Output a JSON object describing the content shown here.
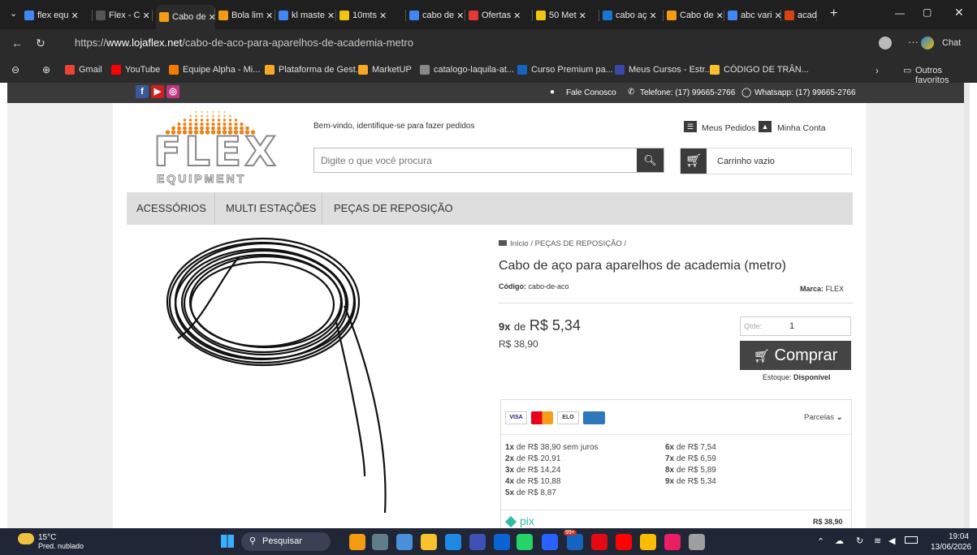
{
  "browser": {
    "tabs": [
      {
        "label": "flex equ",
        "color": "#4285f4"
      },
      {
        "label": "Flex - C",
        "color": "#555555"
      },
      {
        "label": "Cabo de",
        "color": "#f39c12",
        "active": true
      },
      {
        "label": "Bola lim",
        "color": "#f39c12"
      },
      {
        "label": "kl maste",
        "color": "#4285f4"
      },
      {
        "label": "10mts",
        "color": "#f1c40f"
      },
      {
        "label": "cabo de",
        "color": "#4285f4"
      },
      {
        "label": "Ofertas",
        "color": "#e53935"
      },
      {
        "label": "50 Met",
        "color": "#f1c40f"
      },
      {
        "label": "cabo aç",
        "color": "#1976d2"
      },
      {
        "label": "Cabo de",
        "color": "#f39c12"
      },
      {
        "label": "abc vari",
        "color": "#4285f4"
      },
      {
        "label": "academ",
        "color": "#d84315"
      }
    ],
    "new_tab": "+",
    "url_prefix": "https://",
    "url_domain": "www.lojaflex.net",
    "url_path": "/cabo-de-aco-para-aparelhos-de-academia-metro",
    "chat_label": "Chat",
    "bookmarks": [
      {
        "label": "Gmail",
        "color": "#ea4335"
      },
      {
        "label": "YouTube",
        "color": "#ff0000"
      },
      {
        "label": "Equipe Alpha - Mi...",
        "color": "#f57c00"
      },
      {
        "label": "Plataforma de Gest...",
        "color": "#f9a825"
      },
      {
        "label": "MarketUP",
        "color": "#f9a825"
      },
      {
        "label": "catalogo-laquila-at...",
        "color": "#888888"
      },
      {
        "label": "Curso Premium pa...",
        "color": "#1565c0"
      },
      {
        "label": "Meus Cursos - Estr...",
        "color": "#3949ab"
      },
      {
        "label": "CÓDIGO DE TRÂN...",
        "color": "#fbc02d"
      }
    ],
    "other_favorites": "Outros favoritos"
  },
  "site": {
    "social": [
      {
        "label": "f",
        "color": "#3b5998"
      },
      {
        "label": "▶",
        "color": "#cd201f"
      },
      {
        "label": "◎",
        "color": "#c13584"
      }
    ],
    "contact": "Fale Conosco",
    "phone": "Telefone: (17) 99665-2766",
    "whatsapp": "Whatsapp: (17) 99665-2766",
    "logo_text": "FLEX",
    "logo_sub": "EQUIPMENT",
    "welcome": "Bem-vindo, identifique-se para fazer pedidos",
    "my_orders": "Meus Pedidos",
    "my_account": "Minha Conta",
    "search_placeholder": "Digite o que você procura",
    "cart_label": "Carrinho vazio",
    "nav": [
      "ACESSÓRIOS",
      "MULTI ESTAÇÕES",
      "PEÇAS DE REPOSIÇÃO"
    ]
  },
  "product": {
    "breadcrumb_home": "Início",
    "breadcrumb_cat": "PEÇAS DE REPOSIÇÃO",
    "breadcrumb_sep": "/",
    "title": "Cabo de aço para aparelhos de academia (metro)",
    "code_label": "Código:",
    "code_value": "cabo-de-aco",
    "brand_label": "Marca:",
    "brand_value": "FLEX",
    "installments_count": "9x",
    "installments_de": "de",
    "installment_price": "R$ 5,34",
    "price": "R$ 38,90",
    "qty_label": "Qtde:",
    "qty_value": "1",
    "buy_label": "Comprar",
    "stock_label": "Estoque:",
    "stock_value": "Disponível",
    "cards": [
      "VISA",
      "MC",
      "ELO",
      "AMEX"
    ],
    "parcelas_label": "Parcelas",
    "parcelas_left": [
      {
        "n": "1x",
        "text": "de R$ 38,90 sem juros"
      },
      {
        "n": "2x",
        "text": "de R$ 20,91"
      },
      {
        "n": "3x",
        "text": "de R$ 14,24"
      },
      {
        "n": "4x",
        "text": "de R$ 10,88"
      },
      {
        "n": "5x",
        "text": "de R$ 8,87"
      }
    ],
    "parcelas_right": [
      {
        "n": "6x",
        "text": "de R$ 7,54"
      },
      {
        "n": "7x",
        "text": "de R$ 6,59"
      },
      {
        "n": "8x",
        "text": "de R$ 5,89"
      },
      {
        "n": "9x",
        "text": "de R$ 5,34"
      }
    ],
    "pix_label": "pix",
    "pix_price": "R$ 38,90"
  },
  "taskbar": {
    "temp": "15°C",
    "weather": "Pred. nublado",
    "search": "Pesquisar",
    "badge": "99+",
    "time": "19:04",
    "date": "13/06/2026"
  }
}
